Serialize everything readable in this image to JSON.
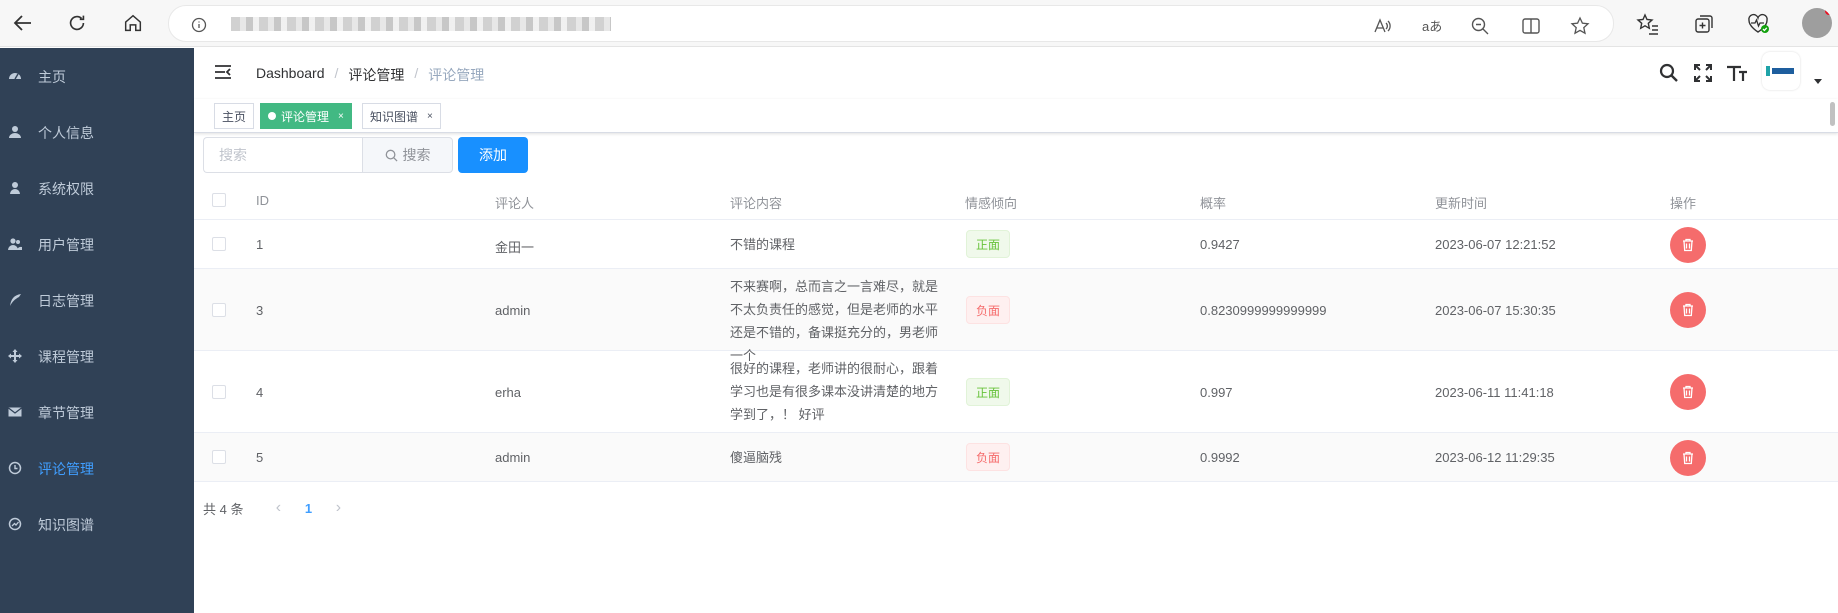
{
  "app": {
    "navbar": {
      "breadcrumb": [
        "Dashboard",
        "评论管理",
        "评论管理"
      ]
    },
    "sidebar": {
      "items": [
        {
          "label": "主页",
          "icon": "dashboard-icon"
        },
        {
          "label": "个人信息",
          "icon": "user-icon"
        },
        {
          "label": "系统权限",
          "icon": "user-icon"
        },
        {
          "label": "用户管理",
          "icon": "peoples-icon"
        },
        {
          "label": "日志管理",
          "icon": "feather-icon"
        },
        {
          "label": "课程管理",
          "icon": "move-icon"
        },
        {
          "label": "章节管理",
          "icon": "mail-icon"
        },
        {
          "label": "评论管理",
          "icon": "clock-icon",
          "active": true
        },
        {
          "label": "知识图谱",
          "icon": "chart-icon"
        }
      ]
    },
    "tags": [
      {
        "label": "主页",
        "closable": false,
        "active": false
      },
      {
        "label": "评论管理",
        "closable": true,
        "active": true
      },
      {
        "label": "知识图谱",
        "closable": true,
        "active": false
      }
    ],
    "tag_close": "×",
    "search": {
      "placeholder": "搜索",
      "button": "搜索"
    },
    "add_button": "添加",
    "table": {
      "columns": [
        "ID",
        "评论人",
        "评论内容",
        "情感倾向",
        "概率",
        "更新时间",
        "操作"
      ],
      "rows": [
        {
          "id": "1",
          "user": "金田一",
          "content": "不错的课程",
          "sentiment": "正面",
          "prob": "0.9427",
          "time": "2023-06-07 12:21:52"
        },
        {
          "id": "3",
          "user": "admin",
          "content": "不来赛啊，总而言之一言难尽，就是不太负责任的感觉，但是老师的水平还是不错的，备课挺充分的，男老师一个",
          "sentiment": "负面",
          "prob": "0.8230999999999999",
          "time": "2023-06-07 15:30:35"
        },
        {
          "id": "4",
          "user": "erha",
          "content": "很好的课程，老师讲的很耐心，跟着学习也是有很多课本没讲清楚的地方学到了，！ 好评",
          "sentiment": "正面",
          "prob": "0.997",
          "time": "2023-06-11 11:41:18"
        },
        {
          "id": "5",
          "user": "admin",
          "content": "傻逼脑残",
          "sentiment": "负面",
          "prob": "0.9992",
          "time": "2023-06-12 11:29:35"
        }
      ]
    },
    "pagination": {
      "total": "共 4 条",
      "current": "1",
      "prev": "‹",
      "next": "›"
    },
    "colors": {
      "sidebar_bg": "#304156",
      "active": "#409eff",
      "tag_active": "#42b983",
      "delete": "#f56c6c",
      "primary": "#1890ff"
    }
  }
}
